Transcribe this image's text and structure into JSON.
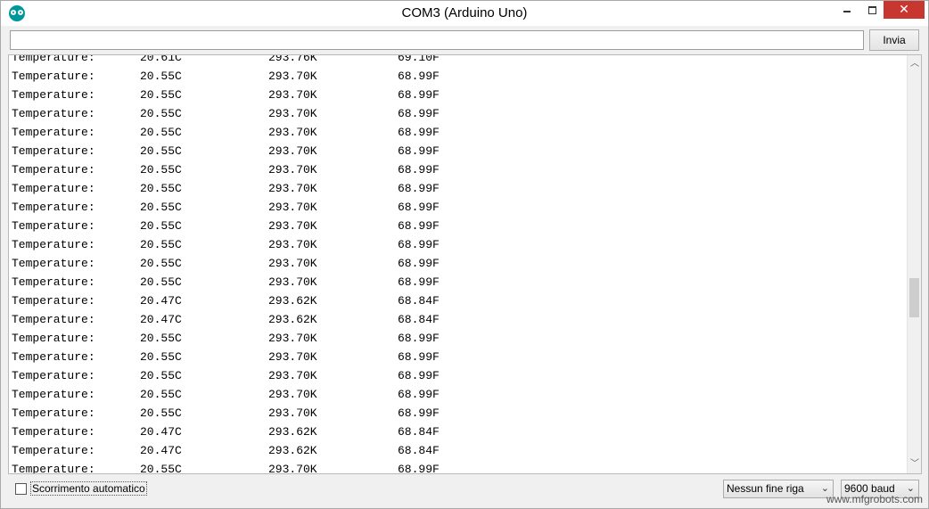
{
  "window": {
    "title": "COM3 (Arduino Uno)",
    "close_glyph": "✕",
    "min_glyph": "",
    "max_glyph": ""
  },
  "send": {
    "input_value": "",
    "button_label": "Invia"
  },
  "output": {
    "partial_top": {
      "label": "Temperature:",
      "c": "20.61C",
      "k": "293.76K",
      "f": "69.10F"
    },
    "lines": [
      {
        "label": "Temperature:",
        "c": "20.55C",
        "k": "293.70K",
        "f": "68.99F"
      },
      {
        "label": "Temperature:",
        "c": "20.55C",
        "k": "293.70K",
        "f": "68.99F"
      },
      {
        "label": "Temperature:",
        "c": "20.55C",
        "k": "293.70K",
        "f": "68.99F"
      },
      {
        "label": "Temperature:",
        "c": "20.55C",
        "k": "293.70K",
        "f": "68.99F"
      },
      {
        "label": "Temperature:",
        "c": "20.55C",
        "k": "293.70K",
        "f": "68.99F"
      },
      {
        "label": "Temperature:",
        "c": "20.55C",
        "k": "293.70K",
        "f": "68.99F"
      },
      {
        "label": "Temperature:",
        "c": "20.55C",
        "k": "293.70K",
        "f": "68.99F"
      },
      {
        "label": "Temperature:",
        "c": "20.55C",
        "k": "293.70K",
        "f": "68.99F"
      },
      {
        "label": "Temperature:",
        "c": "20.55C",
        "k": "293.70K",
        "f": "68.99F"
      },
      {
        "label": "Temperature:",
        "c": "20.55C",
        "k": "293.70K",
        "f": "68.99F"
      },
      {
        "label": "Temperature:",
        "c": "20.55C",
        "k": "293.70K",
        "f": "68.99F"
      },
      {
        "label": "Temperature:",
        "c": "20.55C",
        "k": "293.70K",
        "f": "68.99F"
      },
      {
        "label": "Temperature:",
        "c": "20.47C",
        "k": "293.62K",
        "f": "68.84F"
      },
      {
        "label": "Temperature:",
        "c": "20.47C",
        "k": "293.62K",
        "f": "68.84F"
      },
      {
        "label": "Temperature:",
        "c": "20.55C",
        "k": "293.70K",
        "f": "68.99F"
      },
      {
        "label": "Temperature:",
        "c": "20.55C",
        "k": "293.70K",
        "f": "68.99F"
      },
      {
        "label": "Temperature:",
        "c": "20.55C",
        "k": "293.70K",
        "f": "68.99F"
      },
      {
        "label": "Temperature:",
        "c": "20.55C",
        "k": "293.70K",
        "f": "68.99F"
      },
      {
        "label": "Temperature:",
        "c": "20.55C",
        "k": "293.70K",
        "f": "68.99F"
      },
      {
        "label": "Temperature:",
        "c": "20.47C",
        "k": "293.62K",
        "f": "68.84F"
      },
      {
        "label": "Temperature:",
        "c": "20.47C",
        "k": "293.62K",
        "f": "68.84F"
      },
      {
        "label": "Temperature:",
        "c": "20.55C",
        "k": "293.70K",
        "f": "68.99F"
      }
    ]
  },
  "footer": {
    "autoscroll_label": "Scorrimento automatico",
    "autoscroll_checked": false,
    "line_ending": "Nessun fine riga",
    "baud_rate": "9600 baud"
  },
  "watermark": "www.mfgrobots.com",
  "colors": {
    "close_button": "#c7362f",
    "app_icon": "#00979c"
  }
}
